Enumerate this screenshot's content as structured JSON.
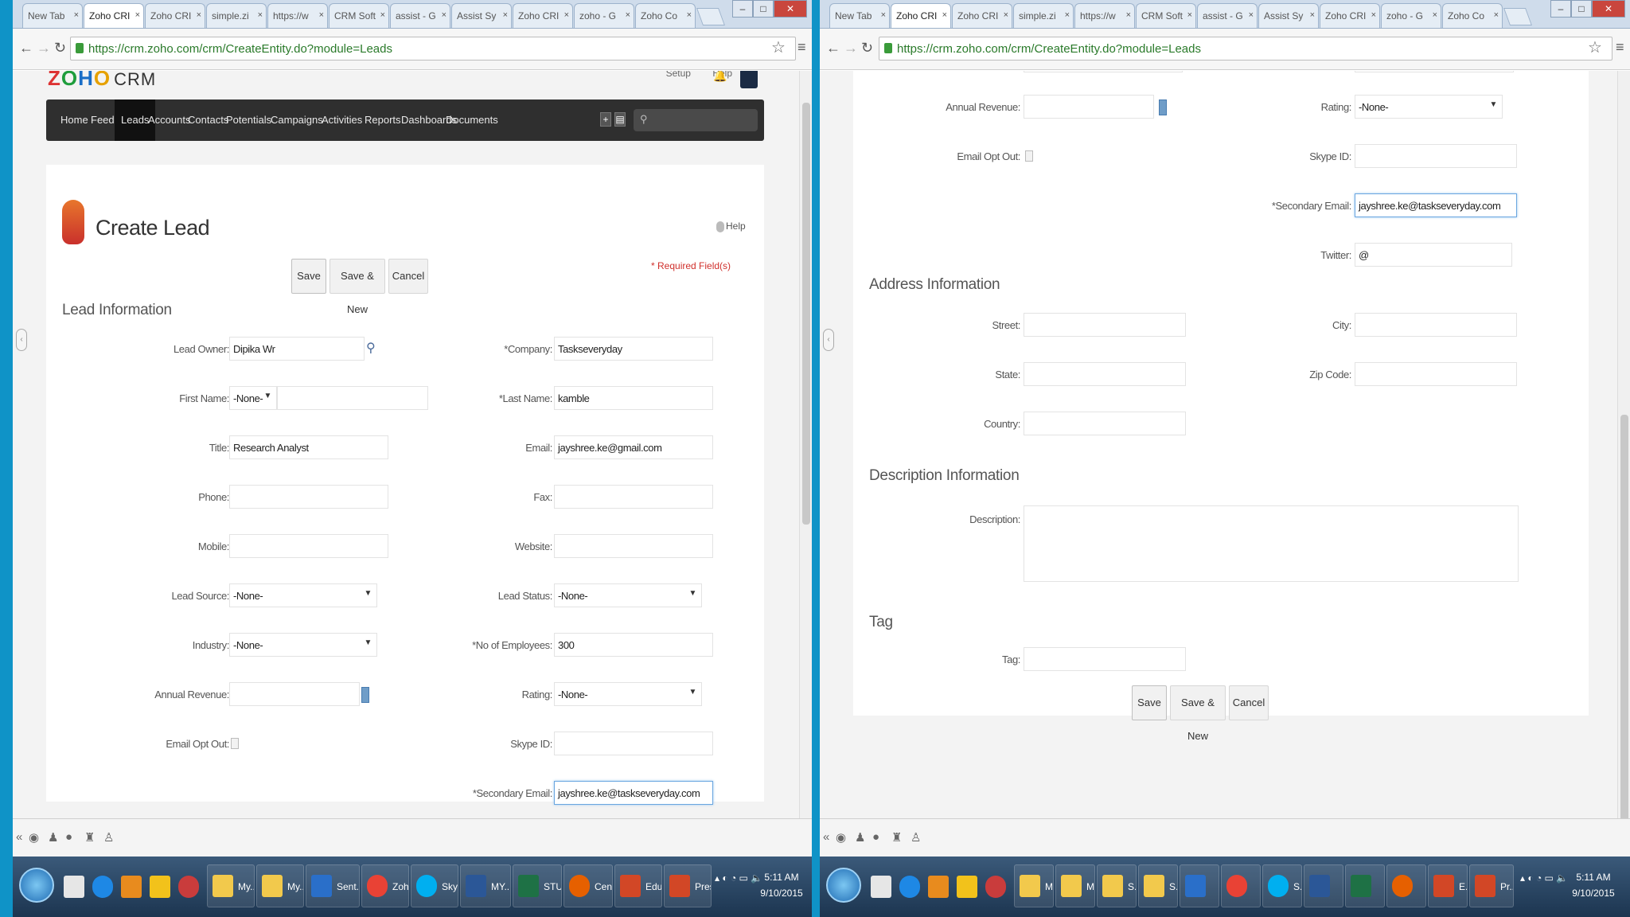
{
  "browser": {
    "tabs": [
      "New Tab",
      "Zoho CRI",
      "Zoho CRI",
      "simple.zi",
      "https://w",
      "CRM Soft",
      "assist - G",
      "Assist Sy",
      "Zoho CRI",
      "zoho - G",
      "Zoho Co"
    ],
    "url": "https://crm.zoho.com/crm/CreateEntity.do?module=Leads"
  },
  "crm": {
    "logo_letters": [
      "Z",
      "O",
      "H",
      "O"
    ],
    "logo_product": "CRM",
    "top_links": [
      "Setup",
      "Help"
    ],
    "nav": [
      "Home",
      "Feeds",
      "Leads",
      "Accounts",
      "Contacts",
      "Potentials",
      "Campaigns",
      "Activities",
      "Reports",
      "Dashboards",
      "Documents"
    ],
    "active_nav": "Leads"
  },
  "form": {
    "title": "Create Lead",
    "help": "Help",
    "required_note": "* Required Field(s)",
    "buttons": {
      "save": "Save",
      "save_new": "Save & New",
      "cancel": "Cancel"
    },
    "sections": {
      "lead": "Lead Information",
      "address": "Address Information",
      "description": "Description Information",
      "tag": "Tag"
    },
    "labels": {
      "lead_owner": "Lead Owner:",
      "first_name": "First Name:",
      "title": "Title:",
      "phone": "Phone:",
      "mobile": "Mobile:",
      "lead_source": "Lead Source:",
      "industry": "Industry:",
      "annual_revenue": "Annual Revenue:",
      "email_opt_out": "Email Opt Out:",
      "company": "*Company:",
      "last_name": "*Last Name:",
      "email": "Email:",
      "fax": "Fax:",
      "website": "Website:",
      "lead_status": "Lead Status:",
      "no_of_employees": "*No of Employees:",
      "rating": "Rating:",
      "skype_id": "Skype ID:",
      "secondary_email": "*Secondary Email:",
      "twitter": "Twitter:",
      "street": "Street:",
      "city": "City:",
      "state": "State:",
      "zip_code": "Zip Code:",
      "country": "Country:",
      "description": "Description:",
      "tag": "Tag:"
    },
    "values": {
      "lead_owner": "Dipika Wr",
      "salutation": "-None-",
      "title": "Research Analyst",
      "lead_source": "-None-",
      "industry": "-None-",
      "company": "Taskseveryday",
      "last_name": "kamble",
      "email": "jayshree.ke@gmail.com",
      "lead_status": "-None-",
      "no_of_employees": "300",
      "rating": "-None-",
      "secondary_email": "jayshree.ke@taskseveryday.com",
      "twitter": "@"
    }
  },
  "taskbar": {
    "left_items": [
      "My...",
      "My...",
      "Sent...",
      "Zoh...",
      "Sky...",
      "MY...",
      "STU...",
      "Cen...",
      "Edu...",
      "Pres..."
    ],
    "right_items": [
      "M...",
      "M...",
      "S...",
      "S...",
      "S...",
      "E...",
      "Pr..."
    ],
    "time": "5:11 AM",
    "date": "9/10/2015"
  }
}
